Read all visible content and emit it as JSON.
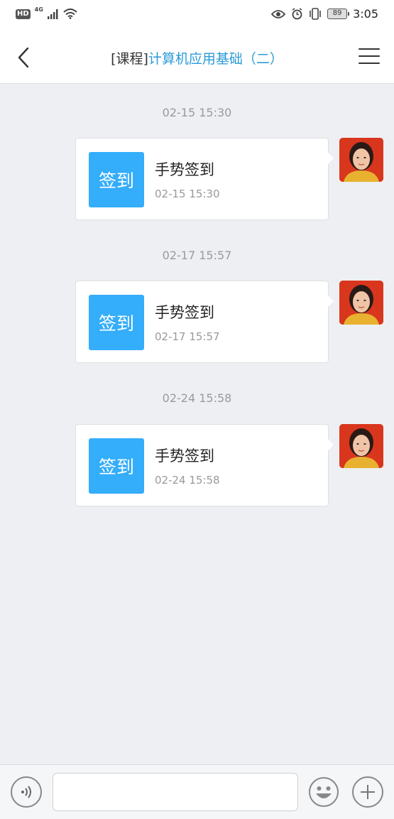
{
  "status_bar": {
    "hd": "HD",
    "network": "4G",
    "battery": "89",
    "time": "3:05"
  },
  "header": {
    "title_prefix": "[课程]",
    "title_main": "计算机应用基础（二）"
  },
  "messages": [
    {
      "timestamp": "02-15 15:30",
      "icon_label": "签到",
      "title": "手势签到",
      "time": "02-15 15:30"
    },
    {
      "timestamp": "02-17 15:57",
      "icon_label": "签到",
      "title": "手势签到",
      "time": "02-17 15:57"
    },
    {
      "timestamp": "02-24 15:58",
      "icon_label": "签到",
      "title": "手势签到",
      "time": "02-24 15:58"
    }
  ],
  "input_bar": {
    "placeholder": ""
  },
  "colors": {
    "accent_blue": "#2b9bd7",
    "sign_icon_bg": "#34adfa",
    "page_bg": "#eeeff3"
  },
  "icons": [
    "hd-icon",
    "signal-icon",
    "wifi-icon",
    "eye-icon",
    "alarm-icon",
    "vibrate-icon",
    "battery-icon",
    "back-icon",
    "menu-icon",
    "voice-icon",
    "emoji-icon",
    "plus-icon"
  ]
}
